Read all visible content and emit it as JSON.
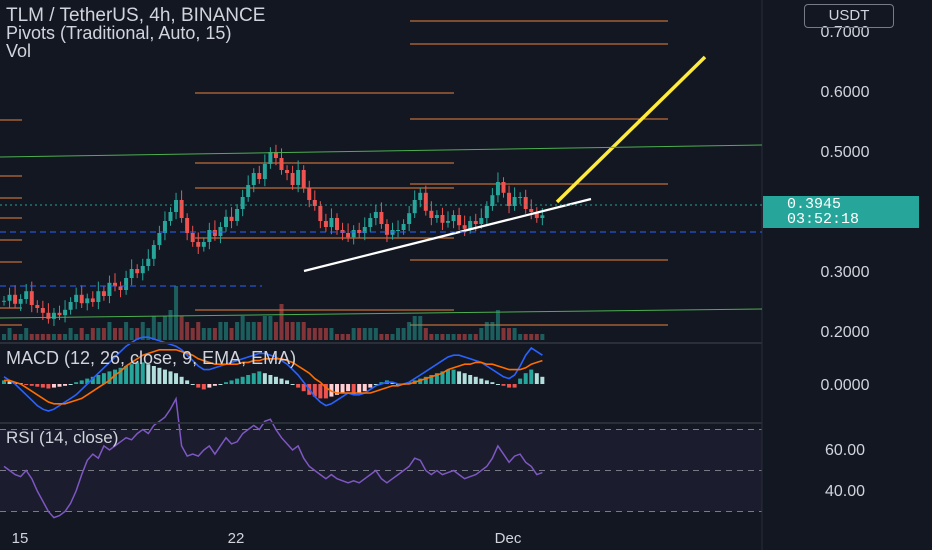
{
  "header": {
    "symbol_line": "TLM / TetherUS, 4h, BINANCE",
    "pivots_line": "Pivots (Traditional, Auto, 15)",
    "vol_line": "Vol"
  },
  "currency_button": "USDT",
  "last_price": {
    "value": "0.3945",
    "countdown": "03:52:18"
  },
  "macd_label": "MACD (12, 26, close, 9, EMA, EMA)",
  "rsi_label": "RSI (14, close)",
  "colors": {
    "up": "#26a69a",
    "down": "#ef5350",
    "pivot": "#e8823a",
    "trend": "#ffeb3b",
    "rsi": "#7e57c2"
  },
  "chart_data": [
    {
      "type": "candlestick",
      "title": "TLM / TetherUS, 4h, BINANCE",
      "ylim": [
        0.16,
        0.74
      ],
      "y_ticks": [
        0.7,
        0.6,
        0.5,
        0.3,
        0.2
      ],
      "y_tick_labels": [
        "0.7000",
        "0.6000",
        "0.5000",
        "0.3000",
        "0.2000"
      ],
      "x_tick_labels": [
        "15",
        "22",
        "Dec"
      ],
      "last_price": 0.3945,
      "close": [
        0.252,
        0.262,
        0.247,
        0.255,
        0.268,
        0.245,
        0.24,
        0.232,
        0.222,
        0.232,
        0.228,
        0.237,
        0.25,
        0.262,
        0.248,
        0.256,
        0.25,
        0.268,
        0.26,
        0.282,
        0.276,
        0.27,
        0.29,
        0.305,
        0.298,
        0.31,
        0.322,
        0.345,
        0.365,
        0.385,
        0.4,
        0.42,
        0.39,
        0.365,
        0.35,
        0.342,
        0.35,
        0.37,
        0.36,
        0.375,
        0.392,
        0.385,
        0.405,
        0.425,
        0.445,
        0.465,
        0.455,
        0.48,
        0.5,
        0.49,
        0.47,
        0.465,
        0.445,
        0.47,
        0.44,
        0.42,
        0.41,
        0.385,
        0.375,
        0.39,
        0.37,
        0.365,
        0.358,
        0.37,
        0.365,
        0.375,
        0.39,
        0.4,
        0.38,
        0.362,
        0.37,
        0.37,
        0.38,
        0.398,
        0.42,
        0.432,
        0.402,
        0.39,
        0.395,
        0.382,
        0.385,
        0.395,
        0.378,
        0.372,
        0.385,
        0.38,
        0.39,
        0.41,
        0.428,
        0.45,
        0.432,
        0.41,
        0.425,
        0.425,
        0.405,
        0.4,
        0.39,
        0.3945
      ]
    },
    {
      "type": "bar",
      "title": "Vol",
      "values": [
        1,
        2,
        1,
        1,
        2,
        1,
        1,
        1,
        1,
        1,
        1,
        1,
        2,
        1,
        2,
        1,
        2,
        2,
        2,
        3,
        2,
        2,
        3,
        2,
        2,
        3,
        2,
        4,
        3,
        4,
        5,
        9,
        4,
        3,
        2,
        3,
        2,
        2,
        2,
        3,
        3,
        2,
        3,
        4,
        3,
        3,
        3,
        4,
        4,
        3,
        6,
        3,
        3,
        3,
        3,
        2,
        2,
        2,
        2,
        2,
        1,
        1,
        1,
        2,
        2,
        2,
        2,
        2,
        1,
        1,
        1,
        2,
        2,
        3,
        4,
        4,
        2,
        1,
        1,
        1,
        1,
        1,
        1,
        1,
        1,
        1,
        2,
        3,
        3,
        5,
        2,
        2,
        2,
        1,
        1,
        1,
        1,
        1
      ]
    },
    {
      "type": "bar",
      "title": "MACD (12, 26, close, 9, EMA, EMA)",
      "y_ticks": [
        0
      ],
      "y_tick_labels": [
        "0.0000"
      ],
      "values": [
        0.002,
        0.0015,
        0.001,
        0.0005,
        -0.0005,
        -0.001,
        -0.0015,
        -0.002,
        -0.0025,
        -0.002,
        -0.0015,
        -0.001,
        0.0,
        0.001,
        0.002,
        0.003,
        0.004,
        0.005,
        0.006,
        0.007,
        0.008,
        0.009,
        0.01,
        0.011,
        0.012,
        0.012,
        0.011,
        0.01,
        0.009,
        0.008,
        0.007,
        0.006,
        0.004,
        0.002,
        0.0,
        -0.002,
        -0.003,
        -0.002,
        -0.001,
        0.0,
        0.001,
        0.002,
        0.003,
        0.004,
        0.005,
        0.006,
        0.007,
        0.006,
        0.005,
        0.004,
        0.003,
        0.002,
        0.0,
        -0.002,
        -0.004,
        -0.006,
        -0.007,
        -0.008,
        -0.008,
        -0.007,
        -0.006,
        -0.005,
        -0.004,
        -0.006,
        -0.005,
        -0.004,
        -0.002,
        0.0,
        0.001,
        0.002,
        0.001,
        0.0,
        0.0,
        0.001,
        0.002,
        0.003,
        0.004,
        0.005,
        0.006,
        0.007,
        0.008,
        0.008,
        0.007,
        0.006,
        0.005,
        0.004,
        0.003,
        0.002,
        0.001,
        0.0,
        -0.001,
        -0.002,
        -0.002,
        0.003,
        0.006,
        0.008,
        0.006,
        0.004
      ],
      "series": [
        {
          "values": [
            0.004,
            0.002,
            0.0,
            -0.003,
            -0.006,
            -0.009,
            -0.012,
            -0.014,
            -0.015,
            -0.014,
            -0.012,
            -0.01,
            -0.008,
            -0.006,
            -0.003,
            0.0,
            0.003,
            0.006,
            0.009,
            0.012,
            0.015,
            0.018,
            0.021,
            0.023,
            0.025,
            0.026,
            0.026,
            0.025,
            0.024,
            0.023,
            0.022,
            0.021,
            0.019,
            0.016,
            0.013,
            0.01,
            0.008,
            0.008,
            0.009,
            0.01,
            0.011,
            0.012,
            0.013,
            0.014,
            0.015,
            0.016,
            0.017,
            0.017,
            0.016,
            0.015,
            0.013,
            0.011,
            0.008,
            0.005,
            0.001,
            -0.003,
            -0.007,
            -0.01,
            -0.012,
            -0.011,
            -0.009,
            -0.007,
            -0.005,
            -0.006,
            -0.006,
            -0.005,
            -0.003,
            -0.001,
            0.0,
            0.001,
            0.001,
            0.0,
            0.0,
            0.001,
            0.003,
            0.005,
            0.007,
            0.009,
            0.011,
            0.013,
            0.015,
            0.016,
            0.016,
            0.015,
            0.014,
            0.013,
            0.012,
            0.01,
            0.008,
            0.006,
            0.004,
            0.003,
            0.005,
            0.01,
            0.016,
            0.02,
            0.018,
            0.016
          ]
        },
        {
          "values": [
            0.002,
            0.002,
            0.001,
            0.0,
            -0.002,
            -0.004,
            -0.006,
            -0.008,
            -0.01,
            -0.011,
            -0.011,
            -0.011,
            -0.01,
            -0.009,
            -0.008,
            -0.006,
            -0.004,
            -0.002,
            0.0,
            0.002,
            0.005,
            0.007,
            0.01,
            0.012,
            0.014,
            0.016,
            0.017,
            0.018,
            0.019,
            0.019,
            0.019,
            0.019,
            0.018,
            0.017,
            0.016,
            0.014,
            0.013,
            0.012,
            0.011,
            0.011,
            0.011,
            0.011,
            0.011,
            0.012,
            0.012,
            0.013,
            0.013,
            0.014,
            0.014,
            0.014,
            0.014,
            0.013,
            0.012,
            0.01,
            0.008,
            0.006,
            0.003,
            0.001,
            -0.002,
            -0.004,
            -0.005,
            -0.005,
            -0.005,
            -0.005,
            -0.005,
            -0.005,
            -0.005,
            -0.004,
            -0.003,
            -0.002,
            -0.001,
            -0.001,
            0.0,
            0.0,
            0.001,
            0.002,
            0.003,
            0.004,
            0.005,
            0.006,
            0.008,
            0.009,
            0.01,
            0.011,
            0.011,
            0.012,
            0.012,
            0.011,
            0.011,
            0.01,
            0.009,
            0.008,
            0.008,
            0.008,
            0.009,
            0.011,
            0.012,
            0.013
          ]
        }
      ]
    },
    {
      "type": "line",
      "title": "RSI (14, close)",
      "y_ticks": [
        60,
        40
      ],
      "y_tick_labels": [
        "60.00",
        "40.00"
      ],
      "series": [
        {
          "values": [
            52,
            50,
            48,
            47,
            50,
            46,
            40,
            35,
            30,
            27,
            28,
            30,
            34,
            40,
            48,
            55,
            58,
            56,
            62,
            60,
            62,
            64,
            66,
            65,
            68,
            70,
            68,
            72,
            74,
            76,
            80,
            85,
            62,
            57,
            58,
            57,
            60,
            62,
            58,
            62,
            66,
            63,
            64,
            68,
            70,
            72,
            70,
            74,
            75,
            70,
            66,
            63,
            60,
            62,
            56,
            52,
            50,
            48,
            46,
            48,
            46,
            45,
            44,
            45,
            44,
            46,
            48,
            50,
            46,
            44,
            46,
            48,
            50,
            52,
            56,
            55,
            50,
            48,
            50,
            48,
            49,
            50,
            48,
            46,
            47,
            48,
            50,
            52,
            56,
            62,
            58,
            54,
            57,
            58,
            54,
            52,
            48,
            49
          ]
        }
      ]
    }
  ]
}
